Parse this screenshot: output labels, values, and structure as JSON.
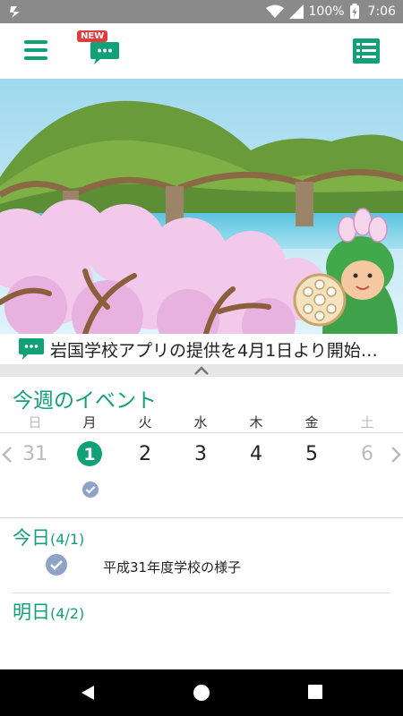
{
  "status_bar": {
    "battery": "100%",
    "time": "7:06",
    "icons": [
      "app-notification-icon",
      "wifi-icon",
      "signal-icon",
      "battery-charging-icon"
    ]
  },
  "app_bar": {
    "new_badge": "NEW",
    "icons": [
      "menu-icon",
      "chat-icon",
      "list-icon"
    ],
    "accent_color": "#12a079"
  },
  "news": {
    "text": "岩国学校アプリの提供を4月1日より開始…"
  },
  "week": {
    "title": "今週のイベント",
    "weekdays": [
      "日",
      "月",
      "火",
      "水",
      "木",
      "金",
      "土"
    ],
    "dates": [
      "31",
      "1",
      "2",
      "3",
      "4",
      "5",
      "6"
    ],
    "selected_index": 1
  },
  "today": {
    "title": "今日",
    "date": "(4/1)",
    "events": [
      {
        "label": "平成31年度学校の様子",
        "checked": true
      }
    ]
  },
  "tomorrow": {
    "title": "明日",
    "date": "(4/2)"
  }
}
